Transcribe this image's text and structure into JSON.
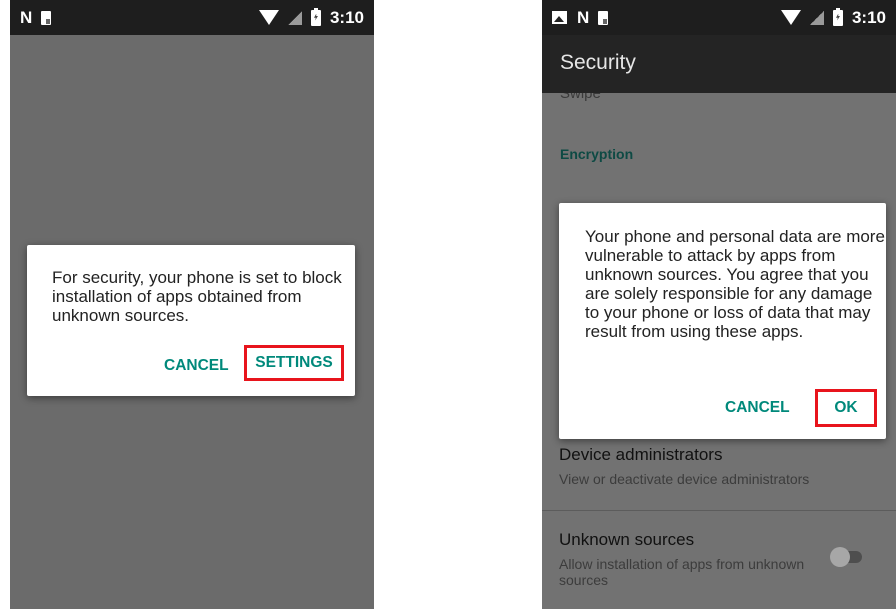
{
  "left": {
    "status": {
      "time": "3:10",
      "icons_left": [
        "n-icon",
        "sim-icon"
      ],
      "icons_right": [
        "wifi-icon",
        "no-signal-icon",
        "battery-icon"
      ]
    },
    "dialog": {
      "message": "For security, your phone is set to block installation of apps obtained from unknown sources.",
      "cancel_label": "CANCEL",
      "settings_label": "SETTINGS"
    }
  },
  "right": {
    "status": {
      "time": "3:10",
      "icons_left": [
        "image-icon",
        "n-icon",
        "sim-icon"
      ],
      "icons_right": [
        "wifi-icon",
        "no-signal-icon",
        "battery-icon"
      ]
    },
    "appbar": {
      "title": "Security"
    },
    "cut_item": "Swipe",
    "category": "Encryption",
    "dialog": {
      "message": "Your phone and personal data are more vulnerable to attack by apps from unknown sources. You agree that you are solely responsible for any damage to your phone or loss of data that may result from using these apps.",
      "cancel_label": "CANCEL",
      "ok_label": "OK"
    },
    "prefs": [
      {
        "title": "Device administrators",
        "summary": "View or deactivate device administrators"
      },
      {
        "title": "Unknown sources",
        "summary": "Allow installation of apps from unknown sources",
        "enabled": false
      }
    ]
  },
  "colors": {
    "accent": "#00897b",
    "highlight": "#e8141c",
    "statusbar": "#1e1e1e",
    "scrim": "#6b6b6b"
  }
}
